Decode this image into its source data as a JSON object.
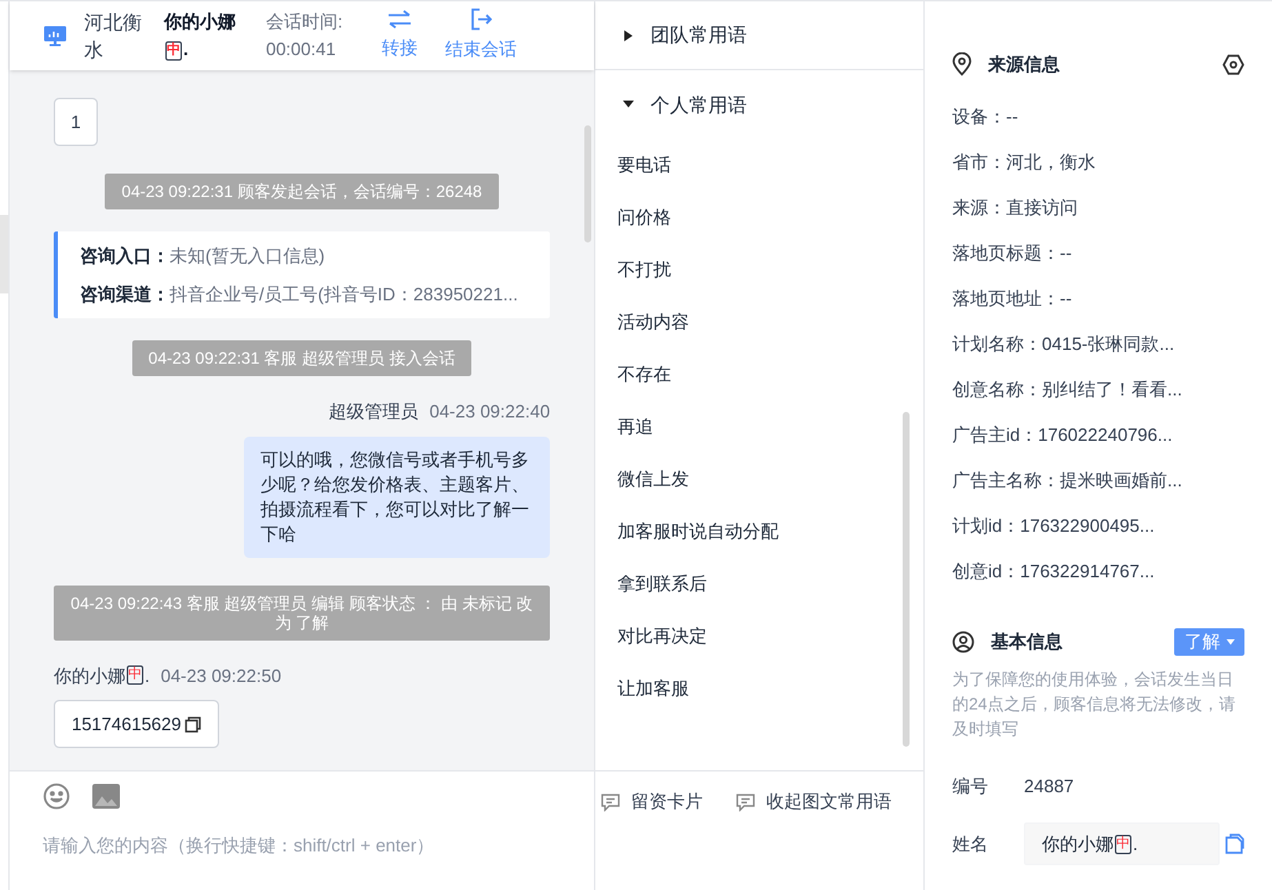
{
  "header": {
    "location": "河北衡水",
    "visitor": {
      "name": "你的小娜",
      "tile": "中",
      "suffix": "."
    },
    "session_time_label": "会话时间:",
    "session_time": "00:00:41",
    "actions": [
      {
        "kind": "transfer",
        "label": "转接"
      },
      {
        "kind": "end",
        "label": "结束会话"
      }
    ]
  },
  "messages": [
    {
      "kind": "card",
      "text": "1"
    },
    {
      "kind": "system",
      "text": "04-23 09:22:31 顾客发起会话，会话编号：26248"
    },
    {
      "kind": "info",
      "rows": [
        {
          "label": "咨询入口：",
          "value": "未知(暂无入口信息)"
        },
        {
          "label": "咨询渠道：",
          "value": "抖音企业号/员工号(抖音号ID：283950221..."
        }
      ]
    },
    {
      "kind": "system",
      "text": "04-23 09:22:31 客服 超级管理员 接入会话"
    },
    {
      "kind": "agent",
      "sender": "超级管理员",
      "time": "04-23 09:22:40",
      "text": "可以的哦，您微信号或者手机号多少呢？给您发价格表、主题客片、拍摄流程看下，您可以对比了解一下哈"
    },
    {
      "kind": "system",
      "text": "04-23 09:22:43 客服 超级管理员 编辑 顾客状态 ： 由 未标记 改为 了解"
    },
    {
      "kind": "customer",
      "sender": {
        "name": "你的小娜",
        "tile": "中",
        "suffix": "."
      },
      "time": "04-23 09:22:50",
      "text": "15174615629"
    }
  ],
  "composer": {
    "placeholder": "请输入您的内容（换行快捷键：shift/ctrl + enter）"
  },
  "phrases": {
    "groups": [
      {
        "title": "团队常用语",
        "expanded": false
      },
      {
        "title": "个人常用语",
        "expanded": true
      }
    ],
    "items": [
      "要电话",
      "问价格",
      "不打扰",
      "活动内容",
      "不存在",
      "再追",
      "微信上发",
      "加客服时说自动分配",
      "拿到联系后",
      "对比再决定",
      "让加客服"
    ],
    "tools": [
      {
        "label": "留资卡片"
      },
      {
        "label": "收起图文常用语"
      }
    ]
  },
  "source_info": {
    "title": "来源信息",
    "rows": [
      "设备：--",
      "省市：河北，衡水",
      "来源：直接访问",
      "落地页标题：--",
      "落地页地址：--",
      "计划名称：0415-张琳同款...",
      "创意名称：别纠结了！看看...",
      "广告主id：176022240796...",
      "广告主名称：提米映画婚前...",
      "计划id：176322900495...",
      "创意id：176322914767..."
    ]
  },
  "basic_info": {
    "title": "基本信息",
    "status": "了解",
    "notice": "为了保障您的使用体验，会话发生当日的24点之后，顾客信息将无法修改，请及时填写",
    "fields": [
      {
        "kind": "text",
        "label": "编号",
        "value": "24887"
      },
      {
        "kind": "input",
        "label": "姓名",
        "value": {
          "name": "你的小娜",
          "tile": "中",
          "suffix": "."
        }
      }
    ]
  }
}
